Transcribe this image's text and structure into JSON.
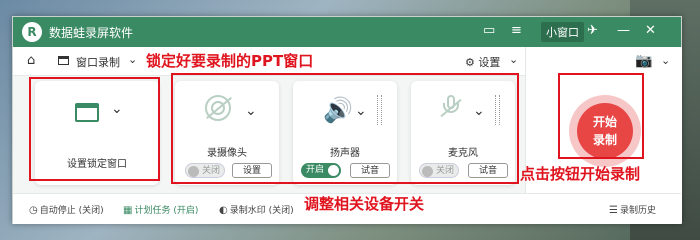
{
  "app": {
    "logo": "R",
    "title": "数据蛙录屏软件",
    "mini_mode": "小窗口",
    "icons": [
      "chat-icon",
      "menu-icon",
      "minimize-icon",
      "mini-window",
      "pin-icon",
      "close-icon"
    ]
  },
  "toolbar": {
    "window_record": "窗口录制",
    "settings": "设置"
  },
  "cards": {
    "window": {
      "label": "设置锁定窗口"
    },
    "camera": {
      "label": "录摄像头",
      "toggle": "关闭",
      "button": "设置"
    },
    "speaker": {
      "label": "扬声器",
      "toggle": "开启",
      "button": "试音"
    },
    "mic": {
      "label": "麦克风",
      "toggle": "关闭",
      "button": "试音"
    }
  },
  "record": {
    "label_top": "开始",
    "label_bottom": "录制"
  },
  "statusbar": {
    "auto_stop": "自动停止 (关闭)",
    "schedule": "计划任务 (开启)",
    "watermark": "录制水印 (关闭)",
    "history": "录制历史"
  },
  "annotations": {
    "top": "锁定好要录制的PPT窗口",
    "bottom": "调整相关设备开关",
    "right": "点击按钮开始录制"
  },
  "colors": {
    "brand": "#3a8a63",
    "annotation": "#e0141e",
    "record": "#e84545"
  }
}
